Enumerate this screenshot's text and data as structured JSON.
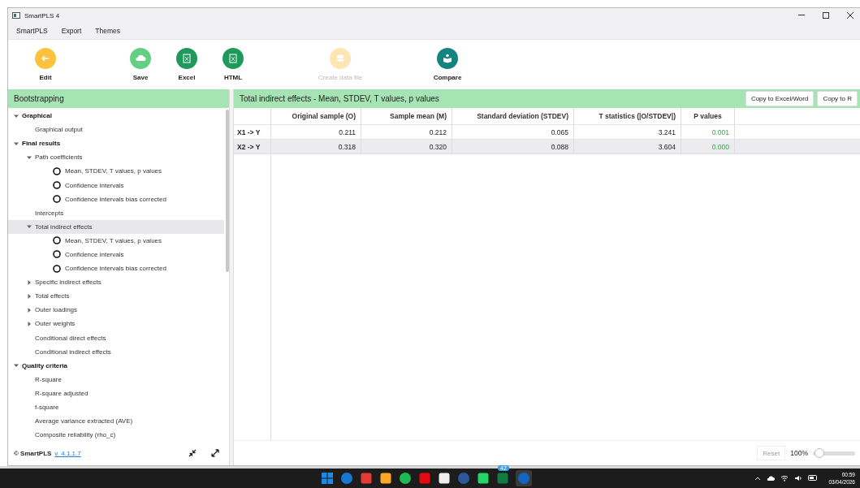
{
  "window": {
    "title": "SmartPLS 4"
  },
  "menu": [
    "SmartPLS",
    "Export",
    "Themes"
  ],
  "toolbar": [
    {
      "label": "Edit",
      "color": "#fbc23e",
      "disabled": false
    },
    {
      "label": "Save",
      "color": "#63cf80",
      "disabled": false
    },
    {
      "label": "Excel",
      "color": "#1f9a5c",
      "disabled": false
    },
    {
      "label": "HTML",
      "color": "#1f9a5c",
      "disabled": false
    },
    {
      "label": "Create data file",
      "color": "#fde6b4",
      "disabled": true
    },
    {
      "label": "Compare",
      "color": "#15837f",
      "disabled": false
    }
  ],
  "sidebar": {
    "title": "Bootstrapping",
    "items": [
      {
        "label": "Graphical",
        "kind": "group",
        "expanded": true,
        "selected": false,
        "children": [
          {
            "label": "Graphical output",
            "kind": "item",
            "selected": false
          }
        ]
      },
      {
        "label": "Final results",
        "kind": "group",
        "expanded": true,
        "selected": false,
        "children": [
          {
            "label": "Path coefficients",
            "kind": "group",
            "expanded": true,
            "selected": false,
            "children": [
              {
                "label": "Mean, STDEV, T values, p values",
                "kind": "radio",
                "selected": false
              },
              {
                "label": "Confidence intervals",
                "kind": "radio",
                "selected": false
              },
              {
                "label": "Confidence intervals bias corrected",
                "kind": "radio",
                "selected": false
              }
            ]
          },
          {
            "label": "Intercepts",
            "kind": "item",
            "selected": false
          },
          {
            "label": "Total indirect effects",
            "kind": "group",
            "expanded": true,
            "selected": true,
            "children": [
              {
                "label": "Mean, STDEV, T values, p values",
                "kind": "radio",
                "selected": false
              },
              {
                "label": "Confidence intervals",
                "kind": "radio",
                "selected": false
              },
              {
                "label": "Confidence intervals bias corrected",
                "kind": "radio",
                "selected": false
              }
            ]
          },
          {
            "label": "Specific indirect effects",
            "kind": "group",
            "expanded": false,
            "selected": false
          },
          {
            "label": "Total effects",
            "kind": "group",
            "expanded": false,
            "selected": false
          },
          {
            "label": "Outer loadings",
            "kind": "group",
            "expanded": false,
            "selected": false
          },
          {
            "label": "Outer weights",
            "kind": "group",
            "expanded": false,
            "selected": false
          },
          {
            "label": "Conditional direct effects",
            "kind": "item",
            "selected": false
          },
          {
            "label": "Conditional indirect effects",
            "kind": "item",
            "selected": false
          }
        ]
      },
      {
        "label": "Quality criteria",
        "kind": "group",
        "expanded": true,
        "selected": false,
        "children": [
          {
            "label": "R-square",
            "kind": "item",
            "selected": false
          },
          {
            "label": "R-square adjusted",
            "kind": "item",
            "selected": false
          },
          {
            "label": "f-square",
            "kind": "item",
            "selected": false
          },
          {
            "label": "Average variance extracted (AVE)",
            "kind": "item",
            "selected": false
          },
          {
            "label": "Composite reliability (rho_c)",
            "kind": "item",
            "selected": false
          }
        ]
      }
    ],
    "footer": {
      "copyright": "© SmartPLS",
      "version": "v. 4.1.1.7"
    }
  },
  "panel": {
    "title": "Total indirect effects - Mean, STDEV, T values, p values",
    "buttons": [
      "Copy to Excel/Word",
      "Copy to R"
    ]
  },
  "table": {
    "columns": [
      "Original sample (O)",
      "Sample mean (M)",
      "Standard deviation (STDEV)",
      "T statistics (|O/STDEV|)",
      "P values"
    ],
    "rows": [
      {
        "label": "X1 -> Y",
        "cells": [
          "0.211",
          "0.212",
          "0.065",
          "3.241",
          "0.001"
        ]
      },
      {
        "label": "X2 -> Y",
        "cells": [
          "0.318",
          "0.320",
          "0.088",
          "3.604",
          "0.000"
        ]
      }
    ]
  },
  "zoom": {
    "reset": "Reset",
    "reading": "100%",
    "level": 0.1
  },
  "taskbar": {
    "badge": "42",
    "time": "00:59",
    "date": "03/04/2026"
  }
}
